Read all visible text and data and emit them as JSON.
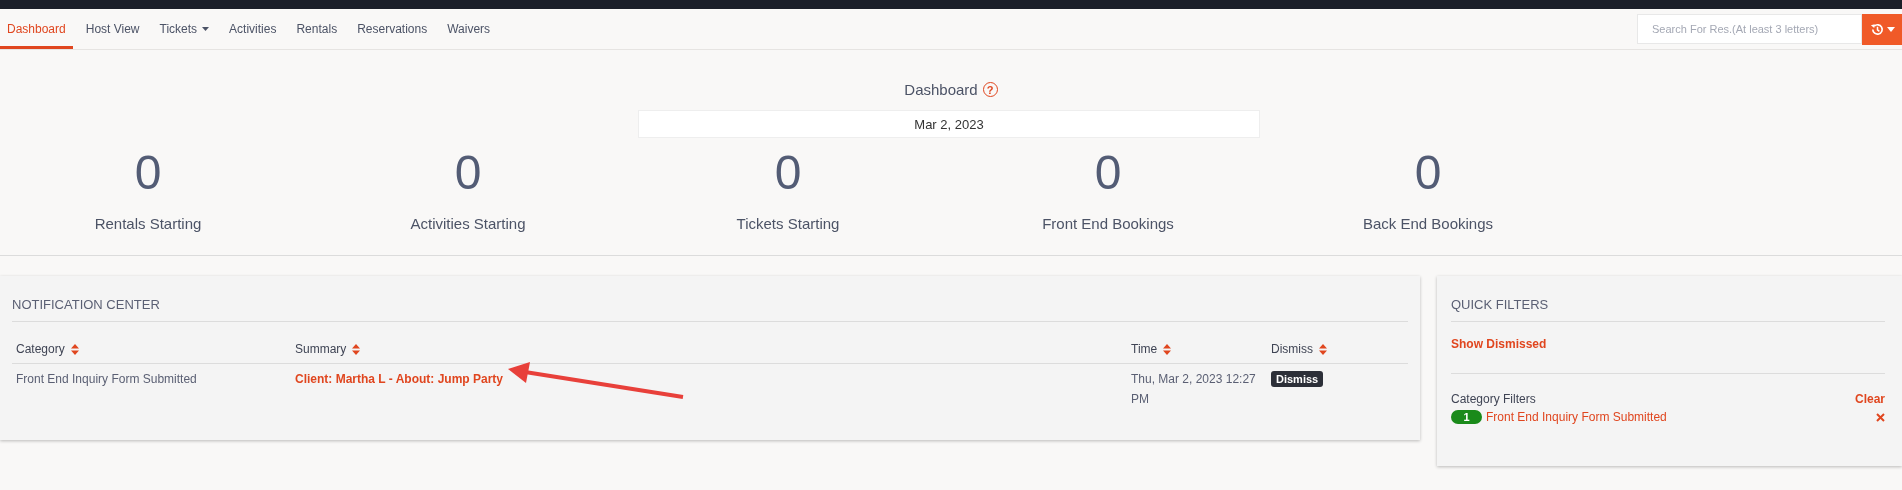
{
  "nav": {
    "tabs": [
      {
        "label": "Dashboard",
        "selected": true,
        "dropdown": false
      },
      {
        "label": "Host View",
        "selected": false,
        "dropdown": false
      },
      {
        "label": "Tickets",
        "selected": false,
        "dropdown": true
      },
      {
        "label": "Activities",
        "selected": false,
        "dropdown": false
      },
      {
        "label": "Rentals",
        "selected": false,
        "dropdown": false
      },
      {
        "label": "Reservations",
        "selected": false,
        "dropdown": false
      },
      {
        "label": "Waivers",
        "selected": false,
        "dropdown": false
      }
    ],
    "search": {
      "placeholder": "Search For Res.(At least 3 letters)"
    }
  },
  "dashboard": {
    "title": "Dashboard",
    "help": "?",
    "date": "Mar 2, 2023",
    "stats": [
      {
        "value": "0",
        "label": "Rentals Starting"
      },
      {
        "value": "0",
        "label": "Activities Starting"
      },
      {
        "value": "0",
        "label": "Tickets Starting"
      },
      {
        "value": "0",
        "label": "Front End Bookings"
      },
      {
        "value": "0",
        "label": "Back End Bookings"
      }
    ]
  },
  "notification_center": {
    "title": "NOTIFICATION CENTER",
    "columns": [
      {
        "label": "Category"
      },
      {
        "label": "Summary"
      },
      {
        "label": "Time"
      },
      {
        "label": "Dismiss"
      }
    ],
    "rows": [
      {
        "category": "Front End Inquiry Form Submitted",
        "summary": "Client: Martha L - About: Jump Party",
        "time": "Thu, Mar 2, 2023 12:27 PM",
        "action": "Dismiss"
      }
    ]
  },
  "quick_filters": {
    "title": "QUICK FILTERS",
    "show_dismissed": "Show Dismissed",
    "category_filters": "Category Filters",
    "clear": "Clear",
    "filters": [
      {
        "count": "1",
        "label": "Front End Inquiry Form Submitted"
      }
    ]
  }
}
